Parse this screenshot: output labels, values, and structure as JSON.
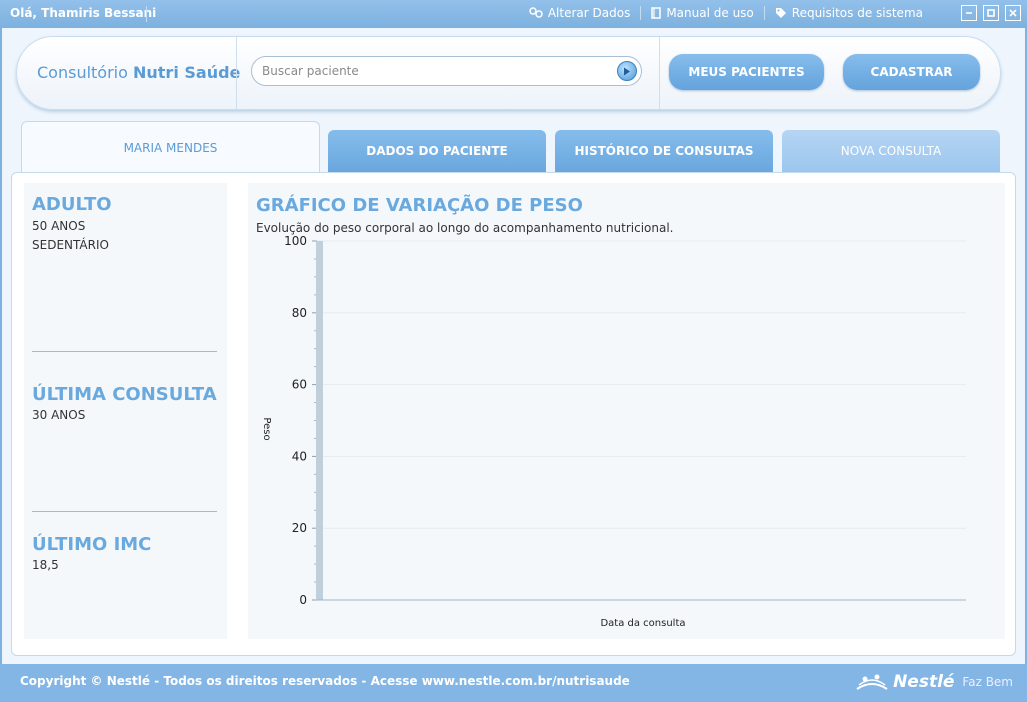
{
  "topbar": {
    "greeting": "Olá, Thamiris Bessani",
    "links": [
      {
        "label": "Alterar Dados",
        "icon": "users-icon"
      },
      {
        "label": "Manual de uso",
        "icon": "book-icon"
      },
      {
        "label": "Requisitos de sistema",
        "icon": "tag-icon"
      }
    ]
  },
  "header": {
    "brand_prefix": "Consultório",
    "brand_name": "Nutri Saúde",
    "search_placeholder": "Buscar paciente",
    "search_value": "",
    "btn_meus_pacientes": "MEUS PACIENTES",
    "btn_cadastrar": "CADASTRAR"
  },
  "tabs": {
    "active": "MARIA MENDES",
    "dados": "DADOS DO PACIENTE",
    "historico": "HISTÓRICO DE CONSULTAS",
    "nova": "NOVA CONSULTA"
  },
  "patient": {
    "category": "ADULTO",
    "age": "50 ANOS",
    "activity": "SEDENTÁRIO",
    "last_consult_heading": "ÚLTIMA CONSULTA",
    "last_consult_value": "30 ANOS",
    "last_imc_heading": "ÚLTIMO IMC",
    "last_imc_value": "18,5"
  },
  "chart_data": {
    "type": "bar",
    "title": "GRÁFICO DE VARIAÇÃO DE PESO",
    "subtitle": "Evolução do peso corporal ao longo do acompanhamento nutricional.",
    "xlabel": "Data da consulta",
    "ylabel": "Peso",
    "ylim": [
      0,
      100
    ],
    "yticks": [
      0,
      20,
      40,
      60,
      80,
      100
    ],
    "grid": true,
    "categories": [],
    "values": []
  },
  "footer": {
    "copyright": "Copyright © Nestlé - Todos os direitos reservados - Acesse www.nestle.com.br/nutrisaude",
    "brand": "Nestlé",
    "slogan": "Faz Bem"
  },
  "colors": {
    "accent": "#6aa9de",
    "frame": "#7fb2e0",
    "button": "#6aa7de"
  }
}
